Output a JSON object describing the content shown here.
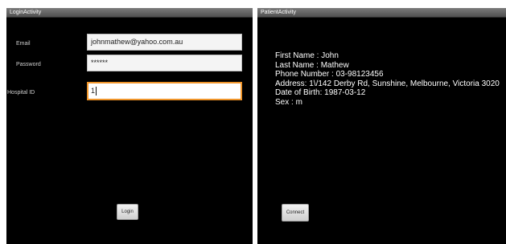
{
  "login": {
    "title": "LoginActivity",
    "email_label": "Email",
    "email_value": "johnmathew@yahoo.com.au",
    "password_label": "Password",
    "password_value": "******",
    "hospital_label": "Hospital ID",
    "hospital_value": "1",
    "login_button": "Login"
  },
  "patient": {
    "title": "PatientActivity",
    "first_name": "First Name : John",
    "last_name": "Last Name : Mathew",
    "phone": "Phone Number : 03-98123456",
    "address": "Address:  1\\/142 Derby Rd,  Sunshine,  Melbourne,  Victoria  3020",
    "dob": "Date of Birth:  1987-03-12",
    "sex": "Sex : m",
    "connect_button": "Connect"
  },
  "colors": {
    "screen_bg": "#000000",
    "focus_accent": "#f0952a",
    "titlebar": "#6a6a6a"
  }
}
